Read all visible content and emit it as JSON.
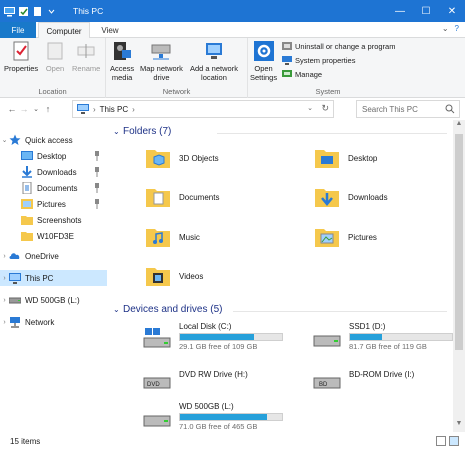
{
  "window": {
    "title": "This PC",
    "minimize": "—",
    "maximize": "☐",
    "close": "✕"
  },
  "tabs": {
    "file": "File",
    "computer": "Computer",
    "view": "View",
    "collapse": "⌄",
    "help": "?"
  },
  "ribbon": {
    "location": {
      "label": "Location",
      "properties": "Properties",
      "open": "Open",
      "rename": "Rename"
    },
    "network": {
      "label": "Network",
      "access_media": "Access\nmedia",
      "map_network_drive": "Map network\ndrive",
      "add_network_location": "Add a network\nlocation"
    },
    "system": {
      "label": "System",
      "open_settings": "Open\nSettings",
      "uninstall": "Uninstall or change a program",
      "system_properties": "System properties",
      "manage": "Manage"
    }
  },
  "address": {
    "path": "This PC",
    "search_placeholder": "Search This PC"
  },
  "nav": {
    "quick_access": "Quick access",
    "items": [
      "Desktop",
      "Downloads",
      "Documents",
      "Pictures",
      "Screenshots",
      "W10FD3E"
    ],
    "onedrive": "OneDrive",
    "this_pc": "This PC",
    "wd": "WD 500GB (L:)",
    "network": "Network"
  },
  "sections": {
    "folders": "Folders (7)",
    "drives": "Devices and drives (5)"
  },
  "folders": [
    "3D Objects",
    "Desktop",
    "Documents",
    "Downloads",
    "Music",
    "Pictures",
    "Videos"
  ],
  "drives": [
    {
      "name": "Local Disk (C:)",
      "free": "29.1 GB free of 109 GB",
      "used_fraction": 0.73
    },
    {
      "name": "SSD1 (D:)",
      "free": "81.7 GB free of 119 GB",
      "used_fraction": 0.31
    },
    {
      "name": "DVD RW Drive (H:)"
    },
    {
      "name": "BD-ROM Drive (I:)"
    },
    {
      "name": "WD 500GB (L:)",
      "free": "71.0 GB free of 465 GB",
      "used_fraction": 0.85
    }
  ],
  "status": {
    "count": "15 items"
  },
  "colors": {
    "accent": "#1e74d3",
    "selection": "#cce8ff",
    "drive_bar": "#26a0da",
    "section_text": "#1e3287",
    "folder": "#f5c84c"
  }
}
